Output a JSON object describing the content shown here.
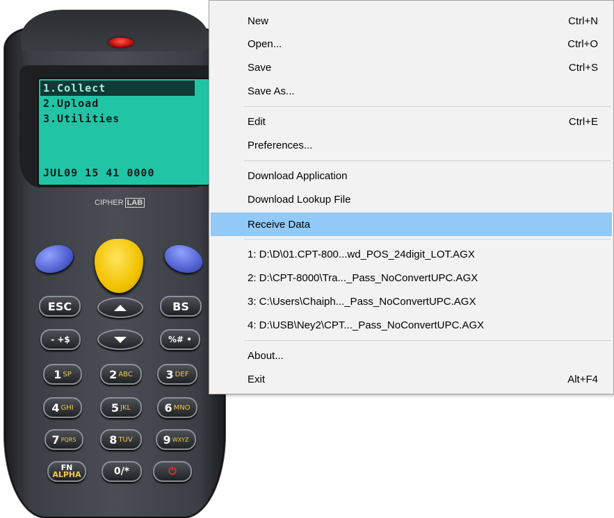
{
  "device": {
    "lcd": {
      "lines": [
        "1.Collect",
        "2.Upload",
        "3.Utilities"
      ],
      "status": "JUL09 15 41 0000"
    },
    "brand": {
      "left": "CIPHER",
      "boxed": "LAB"
    },
    "keys": {
      "esc": "ESC",
      "bs": "BS",
      "minus": "- +$",
      "percent": "%# •",
      "k1": "1",
      "k1s": "SP",
      "k2": "2",
      "k2s": "ABC",
      "k3": "3",
      "k3s": "DEF",
      "k4": "4",
      "k4s": "GHI",
      "k5": "5",
      "k5s": "JKL",
      "k6": "6",
      "k6s": "MNO",
      "k7": "7",
      "k7s": "PQRS",
      "k8": "8",
      "k8s": "TUV",
      "k9": "9",
      "k9s": "WXYZ",
      "fn": "FN",
      "alpha": "ALPHA",
      "k0": "0/*",
      "power": "⏻"
    },
    "colors": {
      "lcd": "#22c4a6",
      "led": "#e00000",
      "scan_key": "#f2c200",
      "soft_key": "#5f6fe0"
    }
  },
  "menu": {
    "items": [
      {
        "label": "New",
        "shortcut": "Ctrl+N"
      },
      {
        "label": "Open...",
        "shortcut": "Ctrl+O"
      },
      {
        "label": "Save",
        "shortcut": "Ctrl+S"
      },
      {
        "label": "Save As...",
        "shortcut": ""
      },
      {
        "label": "Edit",
        "shortcut": "Ctrl+E"
      },
      {
        "label": "Preferences...",
        "shortcut": ""
      },
      {
        "label": "Download Application",
        "shortcut": ""
      },
      {
        "label": "Download Lookup File",
        "shortcut": ""
      },
      {
        "label": "Receive Data",
        "shortcut": "",
        "highlighted": true
      },
      {
        "label": "1: D:\\D\\01.CPT-800...wd_POS_24digit_LOT.AGX",
        "shortcut": ""
      },
      {
        "label": "2: D:\\CPT-8000\\Tra..._Pass_NoConvertUPC.AGX",
        "shortcut": ""
      },
      {
        "label": "3: C:\\Users\\Chaiph..._Pass_NoConvertUPC.AGX",
        "shortcut": ""
      },
      {
        "label": "4: D:\\USB\\Ney2\\CPT..._Pass_NoConvertUPC.AGX",
        "shortcut": ""
      },
      {
        "label": "About...",
        "shortcut": ""
      },
      {
        "label": "Exit",
        "shortcut": "Alt+F4"
      }
    ],
    "highlight_color": "#91c9f7"
  }
}
